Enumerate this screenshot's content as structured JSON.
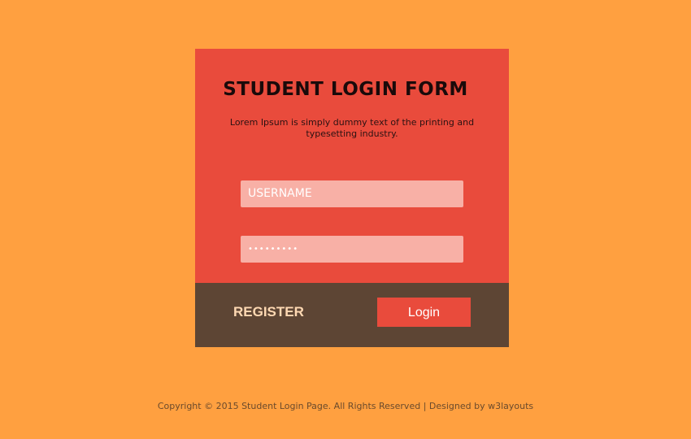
{
  "form": {
    "title": "STUDENT LOGIN FORM",
    "description": "Lorem Ipsum is simply dummy text of the printing and typesetting industry.",
    "username_placeholder": "USERNAME",
    "password_masked": "•••••••••"
  },
  "actions": {
    "register_label": "REGISTER",
    "login_label": "Login"
  },
  "footer": {
    "copyright": "Copyright © 2015 Student Login Page. All Rights Reserved | Designed by w3layouts"
  },
  "colors": {
    "page_background": "#ffa040",
    "card_background": "#e94b3c",
    "input_background": "#f8b0a6",
    "action_bar_background": "#5d4534",
    "register_text": "#ffd9b3",
    "login_button": "#e94b3c"
  }
}
